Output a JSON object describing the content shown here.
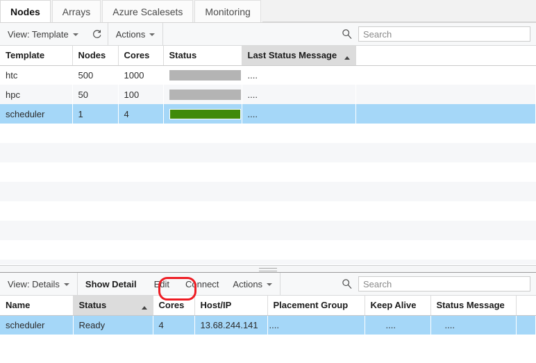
{
  "tabs": [
    {
      "label": "Nodes",
      "active": true
    },
    {
      "label": "Arrays",
      "active": false
    },
    {
      "label": "Azure Scalesets",
      "active": false
    },
    {
      "label": "Monitoring",
      "active": false
    }
  ],
  "top_toolbar": {
    "view_label": "View: Template",
    "refresh_icon": "refresh-icon",
    "actions_label": "Actions",
    "search_icon": "search-icon",
    "search_placeholder": "Search",
    "search_value": ""
  },
  "top_grid": {
    "columns": [
      {
        "label": "Template",
        "sorted": false
      },
      {
        "label": "Nodes",
        "sorted": false
      },
      {
        "label": "Cores",
        "sorted": false
      },
      {
        "label": "Status",
        "sorted": false
      },
      {
        "label": "Last Status Message",
        "sorted": true,
        "sort_dir": "asc"
      },
      {
        "label": "",
        "sorted": false
      }
    ],
    "rows": [
      {
        "template": "htc",
        "nodes": "500",
        "cores": "1000",
        "status_bar": "gray",
        "last_status_message": "....",
        "selected": false
      },
      {
        "template": "hpc",
        "nodes": "50",
        "cores": "100",
        "status_bar": "gray",
        "last_status_message": "....",
        "selected": false
      },
      {
        "template": "scheduler",
        "nodes": "1",
        "cores": "4",
        "status_bar": "green",
        "last_status_message": "....",
        "selected": true
      }
    ]
  },
  "bottom_toolbar": {
    "view_label": "View: Details",
    "show_detail_label": "Show Detail",
    "edit_label": "Edit",
    "connect_label": "Connect",
    "actions_label": "Actions",
    "search_icon": "search-icon",
    "search_placeholder": "Search",
    "search_value": ""
  },
  "annotation": {
    "target": "Edit",
    "color": "#ee1c23",
    "shape": "rounded-rectangle"
  },
  "bottom_grid": {
    "columns": [
      {
        "label": "Name",
        "sorted": false
      },
      {
        "label": "Status",
        "sorted": true,
        "sort_dir": "asc"
      },
      {
        "label": "Cores",
        "sorted": false
      },
      {
        "label": "Host/IP",
        "sorted": false
      },
      {
        "label": "Placement Group",
        "sorted": false
      },
      {
        "label": "Keep Alive",
        "sorted": false
      },
      {
        "label": "Status Message",
        "sorted": false
      },
      {
        "label": "",
        "sorted": false
      }
    ],
    "rows": [
      {
        "name": "scheduler",
        "status": "Ready",
        "cores": "4",
        "host_ip": "13.68.244.141",
        "host_ip_extra": "....",
        "placement_group": "",
        "keep_alive": "....",
        "status_message": "....",
        "selected": true
      }
    ]
  },
  "colors": {
    "selection": "#a5d7f8",
    "status_ok": "#3f8a0a",
    "status_idle": "#b4b4b4",
    "annotation": "#ee1c23",
    "header_sorted": "#dcdcdc"
  }
}
